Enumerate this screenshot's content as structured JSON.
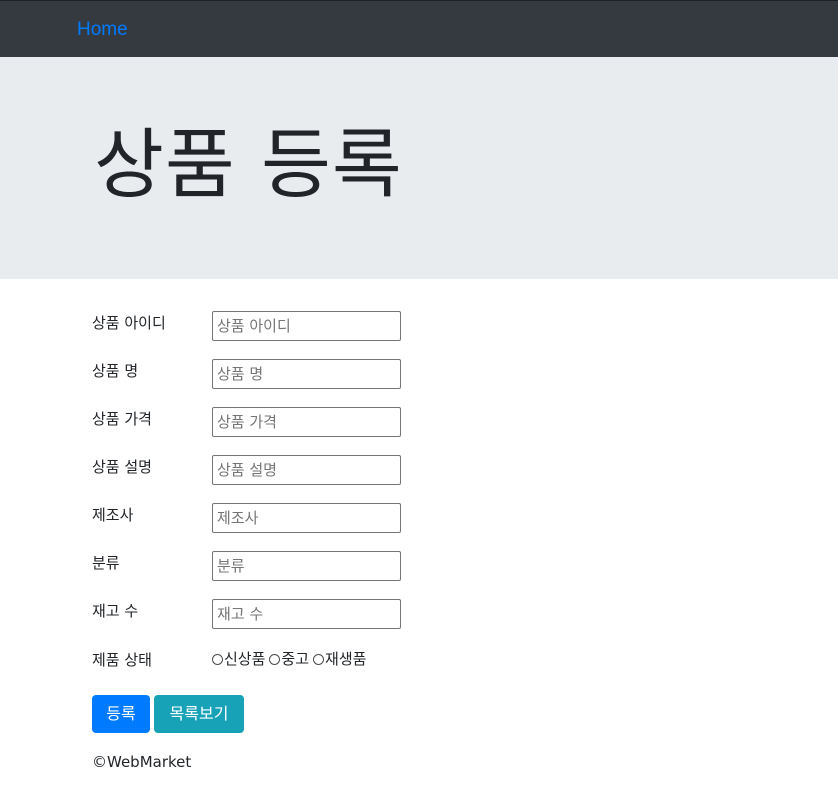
{
  "navbar": {
    "brand": "Home"
  },
  "jumbotron": {
    "title": "상품 등록"
  },
  "form": {
    "fields": [
      {
        "label": "상품 아이디",
        "placeholder": "상품 아이디",
        "value": ""
      },
      {
        "label": "상품 명",
        "placeholder": "상품 명",
        "value": ""
      },
      {
        "label": "상품 가격",
        "placeholder": "상품 가격",
        "value": ""
      },
      {
        "label": "상품 설명",
        "placeholder": "상품 설명",
        "value": ""
      },
      {
        "label": "제조사",
        "placeholder": "제조사",
        "value": ""
      },
      {
        "label": "분류",
        "placeholder": "분류",
        "value": ""
      },
      {
        "label": "재고 수",
        "placeholder": "재고 수",
        "value": ""
      }
    ],
    "condition": {
      "label": "제품 상태",
      "options": [
        "신상품",
        "중고",
        "재생품"
      ],
      "selected": null
    }
  },
  "buttons": {
    "submit": "등록",
    "list": "목록보기"
  },
  "footer": {
    "text": "©WebMarket"
  },
  "colors": {
    "navbar_bg": "#343a40",
    "brand": "#007bff",
    "jumbotron_bg": "#e9ecef",
    "primary": "#007bff",
    "info": "#17a2b8"
  }
}
